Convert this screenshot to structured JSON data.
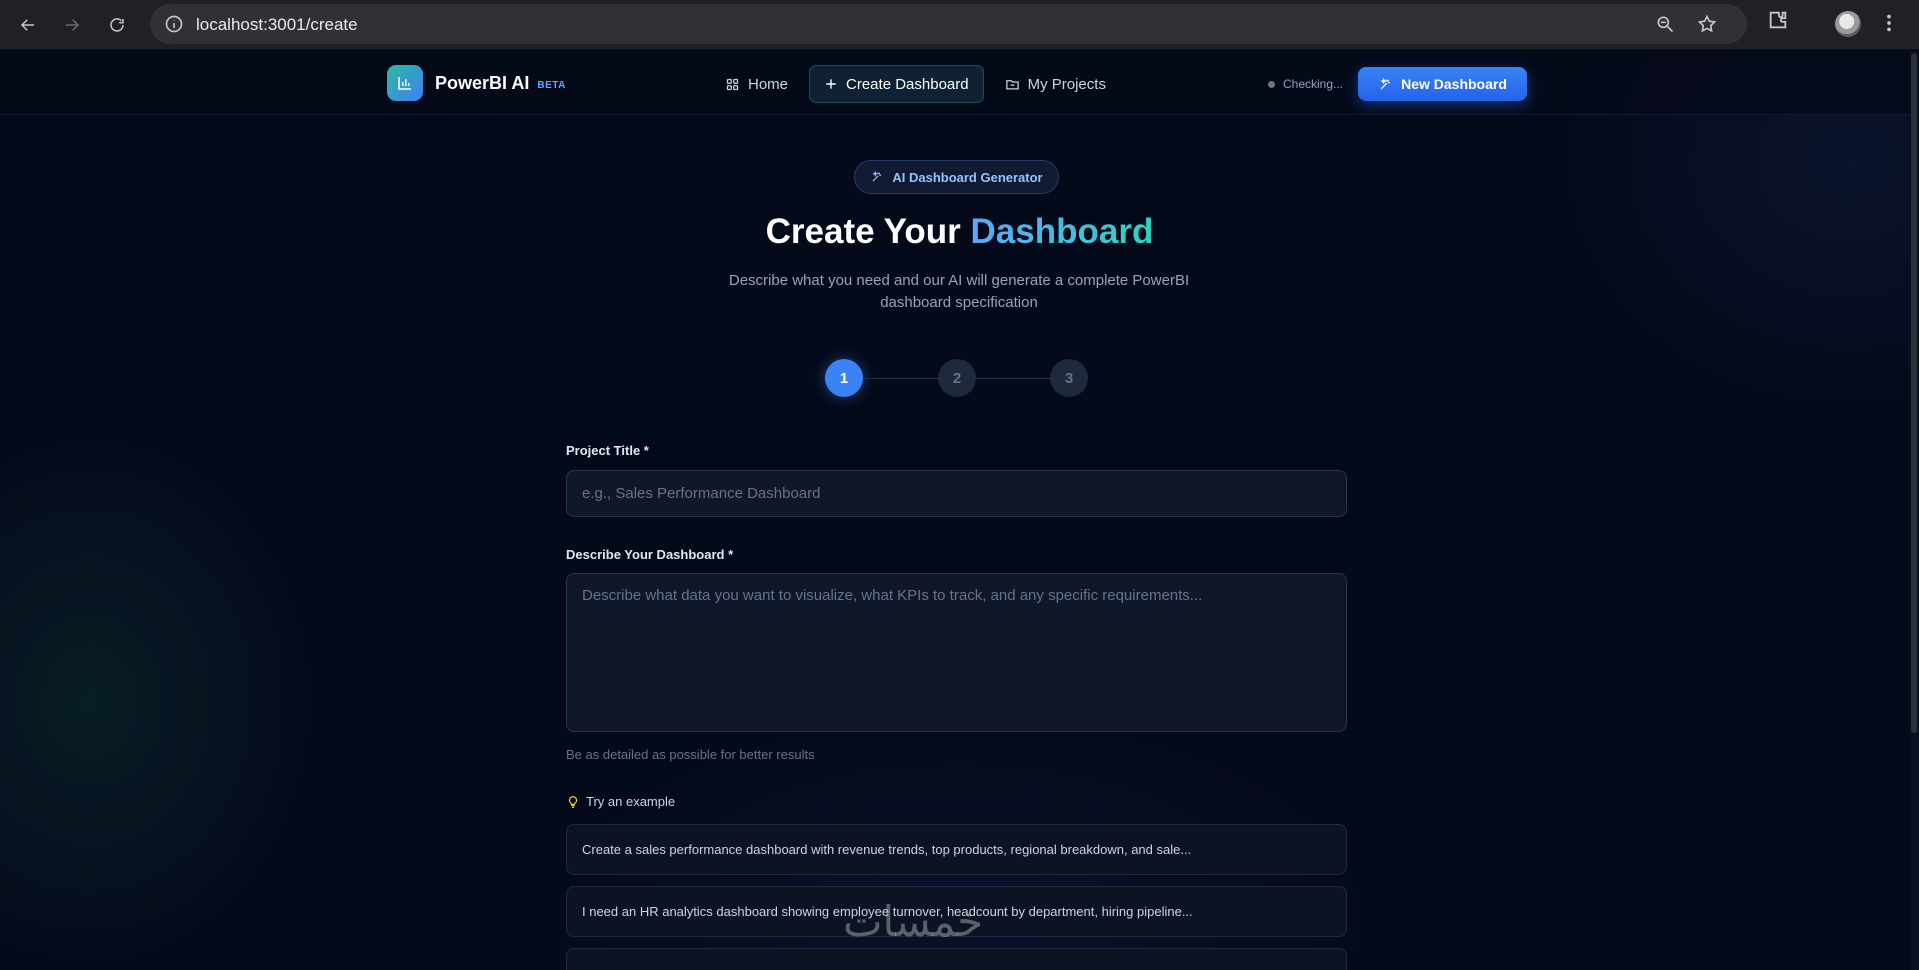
{
  "browser": {
    "url": "localhost:3001/create",
    "icons": [
      "back-icon",
      "forward-icon",
      "reload-icon",
      "info-icon",
      "zoom-icon",
      "star-icon",
      "extensions-icon",
      "avatar",
      "kebab-menu-icon"
    ]
  },
  "nav": {
    "brand_name": "PowerBI AI",
    "brand_badge": "BETA",
    "links": [
      {
        "label": "Home",
        "icon": "grid-icon"
      },
      {
        "label": "Create Dashboard",
        "icon": "plus-icon",
        "active": true
      },
      {
        "label": "My Projects",
        "icon": "folder-icon"
      }
    ],
    "status_text": "Checking...",
    "new_dashboard_label": "New Dashboard"
  },
  "hero": {
    "pill": "AI Dashboard Generator",
    "title_plain": "Create Your ",
    "title_accent": "Dashboard",
    "subtitle": "Describe what you need and our AI will generate a complete PowerBI dashboard specification"
  },
  "stepper": {
    "steps": [
      "1",
      "2",
      "3"
    ],
    "current": 1
  },
  "form": {
    "title_label": "Project Title *",
    "title_placeholder": "e.g., Sales Performance Dashboard",
    "desc_label": "Describe Your Dashboard *",
    "desc_placeholder": "Describe what data you want to visualize, what KPIs to track, and any specific requirements...",
    "desc_hint": "Be as detailed as possible for better results",
    "examples_heading": "Try an example",
    "examples": [
      "Create a sales performance dashboard with revenue trends, top products, regional breakdown, and sale...",
      "I need an HR analytics dashboard showing employee turnover, headcount by department, hiring pipeline..."
    ]
  },
  "watermark": "خمسات",
  "colors": {
    "accent": "#3b82f6",
    "teal": "#2dd4bf",
    "background": "#050a1a"
  }
}
